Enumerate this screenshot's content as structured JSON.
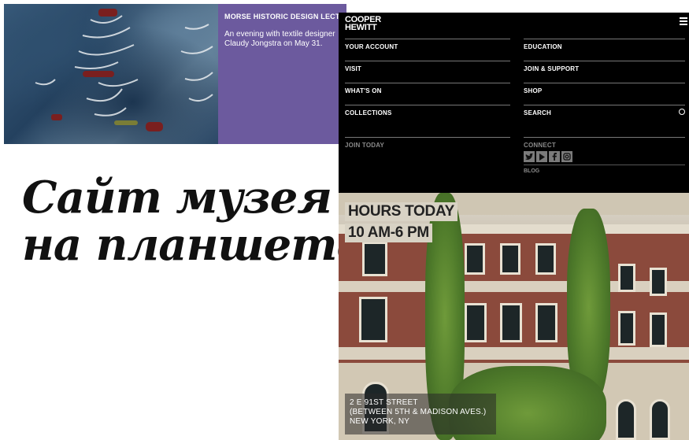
{
  "promo": {
    "title": "MORSE HISTORIC DESIGN LECTURE",
    "description": "An evening with textile designer Claudy Jongstra on May 31."
  },
  "headline": {
    "line1": "Сайт музея",
    "line2": "на планшете"
  },
  "menu": {
    "logo_line1": "COOPER",
    "logo_line2": "HEWITT",
    "left_items": [
      "YOUR ACCOUNT",
      "VISIT",
      "WHAT'S ON",
      "COLLECTIONS"
    ],
    "right_items": [
      "EDUCATION",
      "JOIN & SUPPORT",
      "SHOP",
      "SEARCH"
    ],
    "join_today": "JOIN TODAY",
    "connect": "CONNECT",
    "social": [
      "twitter-icon",
      "youtube-icon",
      "facebook-icon",
      "instagram-icon"
    ],
    "blog": "BLOG"
  },
  "hero": {
    "hours_label": "HOURS TODAY",
    "hours_value": "10 AM-6 PM",
    "address_line1": "2 E 91ST STREET",
    "address_line2": "(BETWEEN 5TH & MADISON AVES.)",
    "address_line3": "NEW YORK, NY"
  },
  "colors": {
    "promo_bg": "#6c5a9e",
    "menu_bg": "#000000",
    "brick": "#8b4a3c"
  }
}
